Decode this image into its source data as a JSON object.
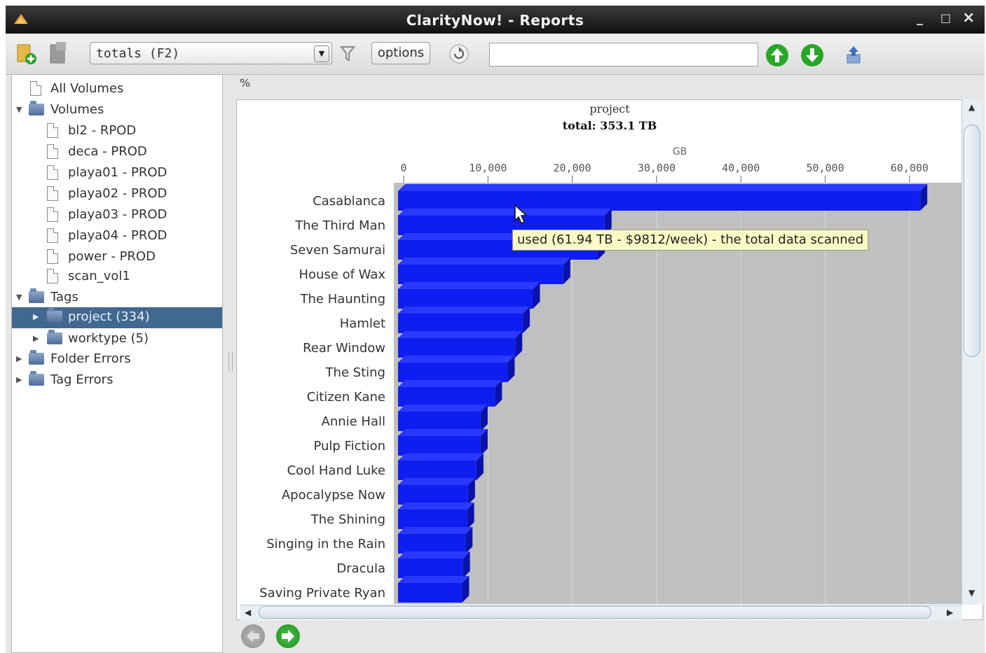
{
  "window": {
    "title": "ClarityNow! - Reports",
    "controls": {
      "minimize": "_",
      "maximize": "□",
      "close": "×"
    }
  },
  "toolbar": {
    "report_select": {
      "value": "totals (F2)"
    },
    "options_label": "options",
    "search": {
      "value": "",
      "placeholder": ""
    },
    "icons": [
      "add-report-icon",
      "remove-report-icon",
      "filter-icon",
      "refresh-icon",
      "scroll-up-icon",
      "scroll-down-icon",
      "export-icon"
    ]
  },
  "sidebar": {
    "items": [
      {
        "label": "All Volumes"
      },
      {
        "label": "Volumes"
      },
      {
        "label": "bl2 - RPOD"
      },
      {
        "label": "deca - PROD"
      },
      {
        "label": "playa01 - PROD"
      },
      {
        "label": "playa02 - PROD"
      },
      {
        "label": "playa03 - PROD"
      },
      {
        "label": "playa04 - PROD"
      },
      {
        "label": "power - PROD"
      },
      {
        "label": "scan_vol1"
      },
      {
        "label": "Tags"
      },
      {
        "label": "project (334)"
      },
      {
        "label": "worktype (5)"
      },
      {
        "label": "Folder Errors"
      },
      {
        "label": "Tag Errors"
      }
    ]
  },
  "report": {
    "unit_label": "%"
  },
  "tooltip": {
    "text": "used (61.94 TB - $9812/week) - the total data scanned"
  },
  "chart_data": {
    "type": "bar",
    "orientation": "horizontal",
    "title": "project",
    "subtitle": "total: 353.1 TB",
    "xlabel": "GB",
    "xlim": [
      0,
      65000
    ],
    "xticks": [
      "0",
      "10,000",
      "20,000",
      "30,000",
      "40,000",
      "50,000",
      "60,000"
    ],
    "grid": true,
    "bar_color": "#0f1ef0",
    "categories": [
      "Casablanca",
      "The Third Man",
      "Seven Samurai",
      "House of Wax",
      "The Haunting",
      "Hamlet",
      "Rear Window",
      "The Sting",
      "Citizen Kane",
      "Annie Hall",
      "Pulp Fiction",
      "Cool Hand Luke",
      "Apocalypse Now",
      "The Shining",
      "Singing in the Rain",
      "Dracula",
      "Saving Private Ryan"
    ],
    "values": [
      61940,
      24500,
      23700,
      19600,
      16000,
      14800,
      13900,
      13000,
      11500,
      9800,
      9800,
      9300,
      8300,
      8200,
      8000,
      7700,
      7600
    ]
  }
}
